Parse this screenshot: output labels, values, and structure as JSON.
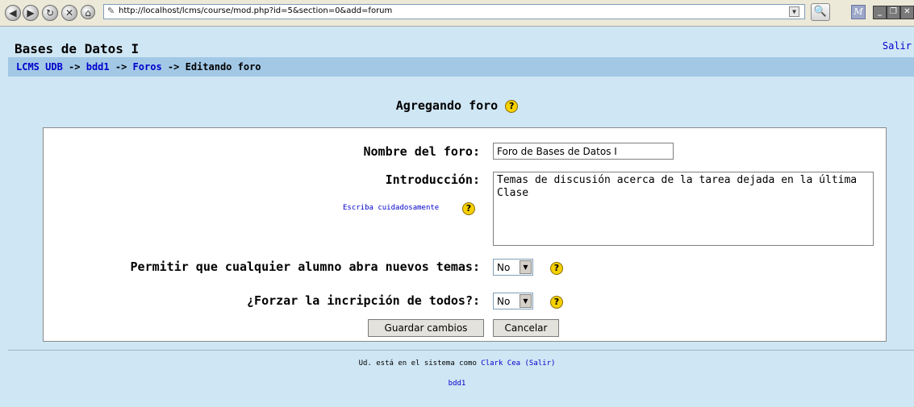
{
  "browser": {
    "back_icon": "back-arrow-icon",
    "forward_icon": "forward-arrow-icon",
    "reload_icon": "reload-icon",
    "stop_icon": "stop-icon",
    "url": "http://localhost/lcms/course/mod.php?id=5&section=0&add=forum"
  },
  "header": {
    "site_title": "Bases de Datos I",
    "logout_label": "Salir"
  },
  "breadcrumb": {
    "home": "LCMS UDB",
    "sep": "->",
    "course": "bdd1",
    "section": "Foros",
    "current": "Editando foro"
  },
  "page": {
    "heading": "Agregando foro"
  },
  "form": {
    "name_label": "Nombre del foro:",
    "name_value": "Foro de Bases de Datos I",
    "intro_label": "Introducción:",
    "intro_value": "Temas de discusión  acerca de la tarea dejada en la última Clase",
    "write_carefully": "Escriba cuidadosamente",
    "allow_label": "Permitir que cualquier alumno abra nuevos temas:",
    "allow_value": "No",
    "force_label": "¿Forzar la incripción de todos?:",
    "force_value": "No",
    "save_label": "Guardar cambios",
    "cancel_label": "Cancelar"
  },
  "footer": {
    "logged_prefix": "Ud. está en el sistema como",
    "user": "Clark Cea",
    "logout": "(Salir)",
    "course": "bdd1"
  },
  "colors": {
    "background": "#cfe6f4",
    "navbar": "#a2c8e6",
    "link": "#0000cc",
    "help_icon": "#f5d000"
  }
}
